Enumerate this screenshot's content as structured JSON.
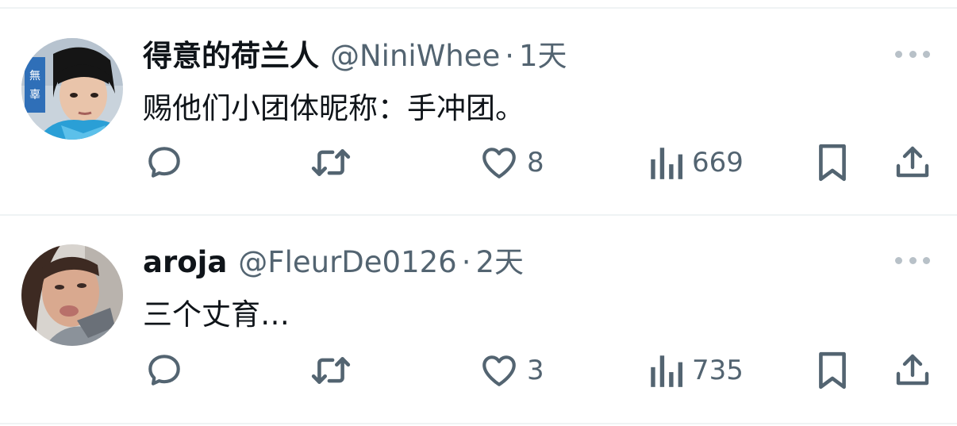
{
  "tweets": [
    {
      "display_name": "得意的荷兰人",
      "handle": "@NiniWhee",
      "separator": "·",
      "time": "1天",
      "text": "赐他们小团体昵称：手冲团。",
      "likes": "8",
      "views": "669"
    },
    {
      "display_name": "aroja",
      "handle": "@FleurDe0126",
      "separator": "·",
      "time": "2天",
      "text": "三个丈育…",
      "likes": "3",
      "views": "735"
    }
  ],
  "colors": {
    "icon": "#536471",
    "secondary_text": "#536471",
    "primary_text": "#0f1419",
    "divider": "#eff3f4"
  },
  "icons": [
    "reply-icon",
    "retweet-icon",
    "like-icon",
    "views-icon",
    "bookmark-icon",
    "share-icon",
    "more-icon"
  ]
}
